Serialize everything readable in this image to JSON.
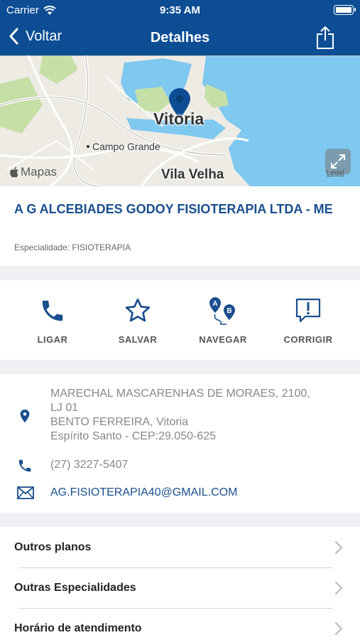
{
  "status_bar": {
    "carrier": "Carrier",
    "time": "9:35 AM"
  },
  "nav": {
    "back_label": "Voltar",
    "title": "Detalhes",
    "share_icon": "share-icon"
  },
  "map": {
    "city_main": "Vitoria",
    "city_secondary": "Campo Grande",
    "city_tertiary": "Vila Velha",
    "brand": "Mapas",
    "legal": "Legal",
    "colors": {
      "water": "#7fc8ef",
      "land": "#eeebe4",
      "park": "#c5dfa6",
      "pin": "#0c4d94"
    }
  },
  "provider": {
    "name": "A G ALCEBIADES GODOY FISIOTERAPIA LTDA - ME",
    "specialty": "Especialidade: FISIOTERAPIA"
  },
  "actions": [
    {
      "label": "LIGAR",
      "icon": "phone-icon"
    },
    {
      "label": "SALVAR",
      "icon": "star-icon"
    },
    {
      "label": "NAVEGAR",
      "icon": "route-icon"
    },
    {
      "label": "CORRIGIR",
      "icon": "report-icon"
    }
  ],
  "contact": {
    "address_lines": [
      "MARECHAL MASCARENHAS DE MORAES, 2100,",
      "LJ 01",
      "BENTO FERREIRA, Vitoria",
      "Espírito Santo - CEP:29.050-625"
    ],
    "phone": "(27) 3227-5407",
    "email": "AG.FISIOTERAPIA40@GMAIL.COM"
  },
  "links": [
    {
      "label": "Outros planos"
    },
    {
      "label": "Outras Especialidades"
    },
    {
      "label": "Horário de atendimento"
    }
  ],
  "colors": {
    "primary": "#0c4d94",
    "title_text": "#1a4f8e",
    "background": "#efeff4"
  }
}
